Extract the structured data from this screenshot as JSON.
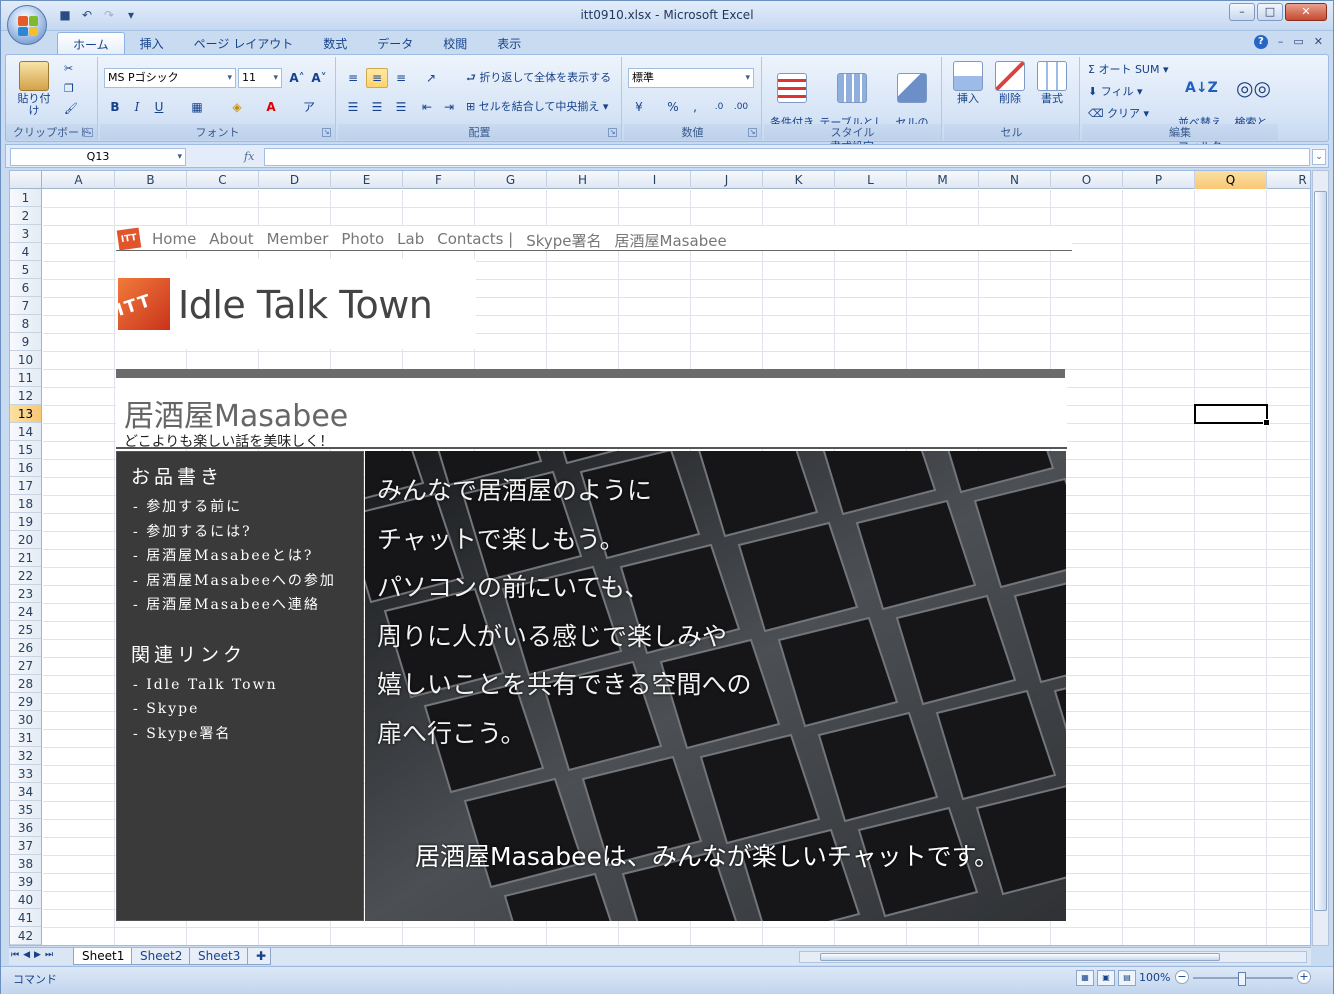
{
  "window": {
    "title": "itt0910.xlsx - Microsoft Excel"
  },
  "ribbon_tabs": [
    "ホーム",
    "挿入",
    "ページ レイアウト",
    "数式",
    "データ",
    "校閲",
    "表示"
  ],
  "ribbon": {
    "clipboard": {
      "label": "クリップボード",
      "paste": "貼り付け"
    },
    "font": {
      "label": "フォント",
      "font_name": "MS Pゴシック",
      "font_size": "11"
    },
    "alignment": {
      "label": "配置",
      "wrap_text": "折り返して全体を表示する",
      "merge_center": "セルを結合して中央揃え"
    },
    "number": {
      "label": "数値",
      "format": "標準"
    },
    "styles": {
      "label": "スタイル",
      "conditional": "条件付き\n書式",
      "as_table": "テーブルとして\n書式設定",
      "cell_styles": "セルの\nスタイル"
    },
    "cells": {
      "label": "セル",
      "insert": "挿入",
      "delete": "削除",
      "format": "書式"
    },
    "editing": {
      "label": "編集",
      "autosum": "オート SUM",
      "fill": "フィル",
      "clear": "クリア",
      "sort_filter": "並べ替えと\nフィルタ",
      "find_select": "検索と\n選択"
    }
  },
  "formula_bar": {
    "name_box": "Q13",
    "fx": "fx",
    "formula": ""
  },
  "columns": [
    "A",
    "B",
    "C",
    "D",
    "E",
    "F",
    "G",
    "H",
    "I",
    "J",
    "K",
    "L",
    "M",
    "N",
    "O",
    "P",
    "Q",
    "R"
  ],
  "selected_column": "Q",
  "rows": [
    "1",
    "2",
    "3",
    "4",
    "5",
    "6",
    "7",
    "8",
    "9",
    "10",
    "11",
    "12",
    "13",
    "14",
    "15",
    "16",
    "17",
    "18",
    "19",
    "20",
    "21",
    "22",
    "23",
    "24",
    "25",
    "26",
    "27",
    "28",
    "29",
    "30",
    "31",
    "32",
    "33",
    "34",
    "35",
    "36",
    "37",
    "38",
    "39",
    "40",
    "41",
    "42"
  ],
  "selected_row": "13",
  "site": {
    "nav_icon": "ITT",
    "nav": [
      "Home",
      "About",
      "Member",
      "Photo",
      "Lab",
      "Contacts |",
      "Skype署名",
      "居酒屋Masabee"
    ],
    "logo_icon": "ITT",
    "logo_text": "Idle Talk Town",
    "page_title": "居酒屋Masabee",
    "page_subtitle": "どこよりも楽しい話を美味しく！",
    "sidebar": {
      "menu_heading": "お品書き",
      "menu": [
        "参加する前に",
        "参加するには?",
        "居酒屋Masabeeとは?",
        "居酒屋Masabeeへの参加",
        "居酒屋Masabeeへ連絡"
      ],
      "links_heading": "関連リンク",
      "links": [
        "Idle Talk Town",
        "Skype",
        "Skype署名"
      ]
    },
    "hero": {
      "lines": [
        "みんなで居酒屋のように",
        "チャットで楽しもう。",
        "パソコンの前にいても、",
        "周りに人がいる感じで楽しみや",
        "嬉しいことを共有できる空間への",
        "扉へ行こう。"
      ],
      "tagline": "居酒屋Masabeeは、みんなが楽しいチャットです。"
    }
  },
  "sheet_tabs": [
    "Sheet1",
    "Sheet2",
    "Sheet3"
  ],
  "active_sheet": "Sheet1",
  "status": {
    "mode": "コマンド",
    "zoom": "100%"
  }
}
